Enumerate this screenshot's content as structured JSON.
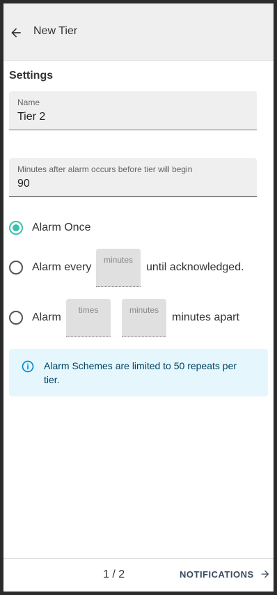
{
  "header": {
    "title": "New Tier",
    "back_icon": "arrow-left-icon"
  },
  "settings": {
    "heading": "Settings"
  },
  "fields": {
    "name": {
      "label": "Name",
      "value": "Tier 2"
    },
    "delay": {
      "label": "Minutes after alarm occurs before tier will begin",
      "value": "90"
    }
  },
  "options": {
    "once": {
      "label": "Alarm Once",
      "selected": true
    },
    "every": {
      "prefix": "Alarm every",
      "minutes_placeholder": "minutes",
      "suffix": "until acknowledged.",
      "selected": false
    },
    "times": {
      "prefix": "Alarm",
      "times_placeholder": "times",
      "minutes_placeholder": "minutes",
      "suffix": "minutes apart",
      "selected": false
    }
  },
  "info": {
    "icon": "info-icon",
    "message": "Alarm Schemes are limited to 50 repeats per tier."
  },
  "footer": {
    "pager": "1 / 2",
    "next_label": "NOTIFICATIONS",
    "next_icon": "arrow-right-icon"
  },
  "colors": {
    "accent": "#3bbfae",
    "info_bg": "#e5f6fd",
    "info_text": "#014361"
  }
}
